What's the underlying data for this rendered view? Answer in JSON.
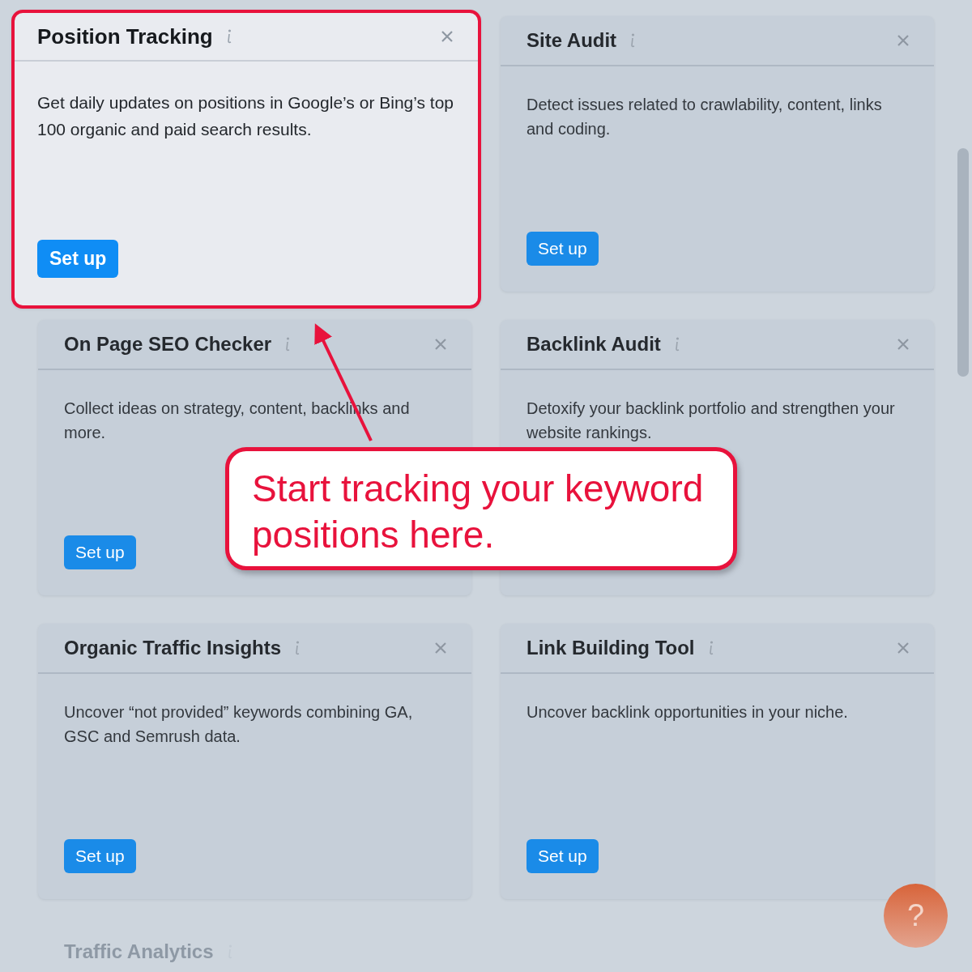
{
  "cards": [
    {
      "title": "Position Tracking",
      "description": "Get daily updates on positions in Google’s or Bing’s top 100 organic and paid search results.",
      "button": "Set up",
      "highlighted": true
    },
    {
      "title": "Site Audit",
      "description": "Detect issues related to crawlability, content, links and coding.",
      "button": "Set up",
      "highlighted": false
    },
    {
      "title": "On Page SEO Checker",
      "description": "Collect ideas on strategy, content, backlinks and more.",
      "button": "Set up",
      "highlighted": false
    },
    {
      "title": "Backlink Audit",
      "description": "Detoxify your backlink portfolio and strengthen your website rankings.",
      "highlighted": false
    },
    {
      "title": "Organic Traffic Insights",
      "description": "Uncover “not provided” keywords combining GA, GSC and Semrush data.",
      "button": "Set up",
      "highlighted": false
    },
    {
      "title": "Link Building Tool",
      "description": "Uncover backlink opportunities in your niche.",
      "button": "Set up",
      "highlighted": false
    },
    {
      "title": "Traffic Analytics",
      "highlighted": false,
      "faded": true
    }
  ],
  "callout": {
    "text": "Start tracking your keyword positions here."
  },
  "help_button": {
    "label": "?"
  }
}
